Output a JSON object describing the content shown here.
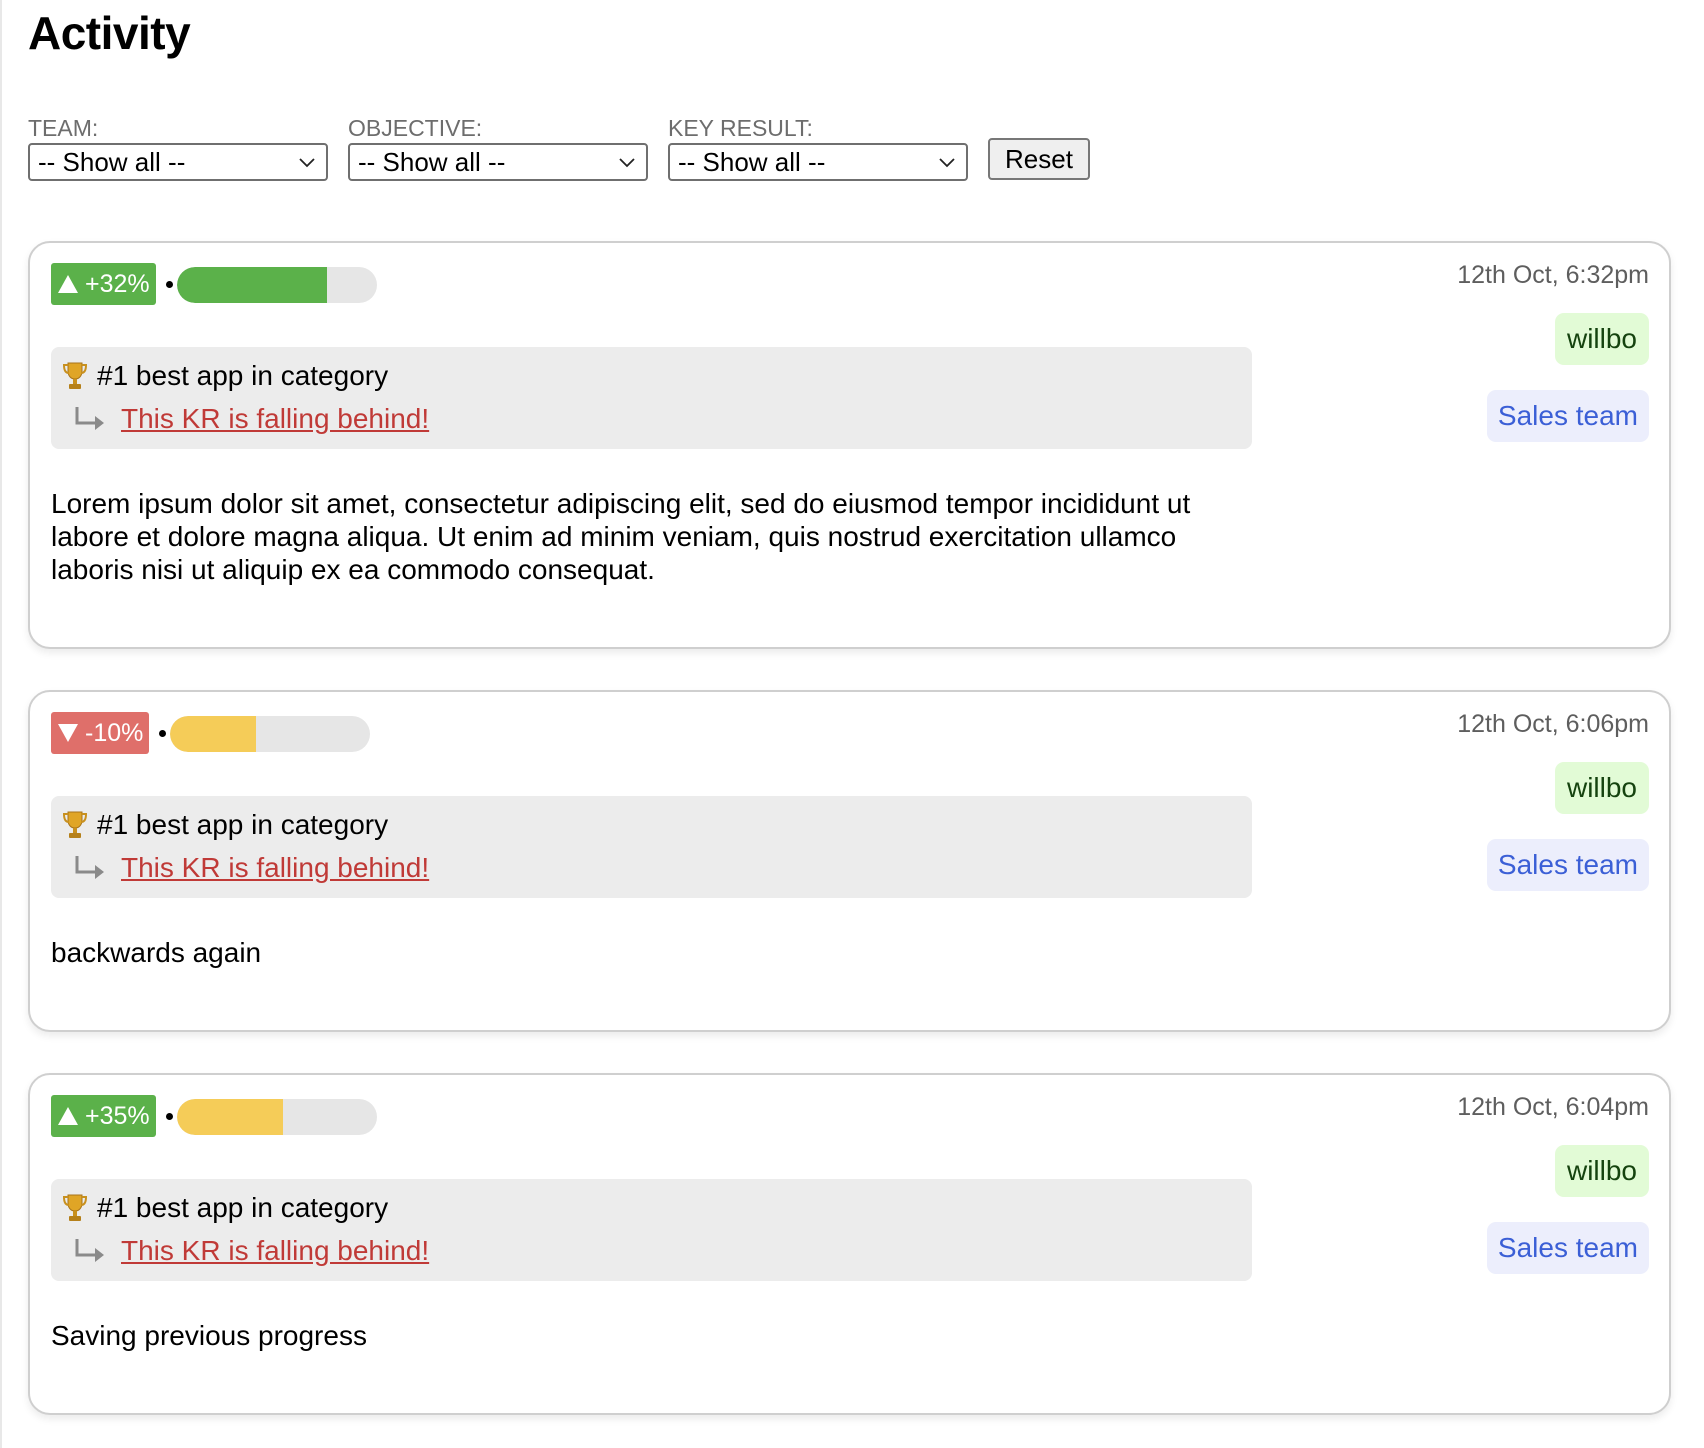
{
  "page": {
    "title": "Activity"
  },
  "filters": {
    "team": {
      "label": "TEAM:",
      "value": "-- Show all --"
    },
    "objective": {
      "label": "OBJECTIVE:",
      "value": "-- Show all --"
    },
    "key_result": {
      "label": "KEY RESULT:",
      "value": "-- Show all --"
    },
    "reset_label": "Reset"
  },
  "colors": {
    "up": "#5bb14a",
    "down": "#df6f6a",
    "progress_green": "#5bb14a",
    "progress_yellow": "#f5cc58",
    "progress_track": "#e6e6e6",
    "link_red": "#c03a37",
    "user_tag_bg": "#e2fbd6",
    "team_tag_bg": "#eceefc",
    "team_tag_text": "#3b5fd6"
  },
  "activities": [
    {
      "direction": "up",
      "change": "+32%",
      "progress": 0.75,
      "progress_color": "green",
      "timestamp": "12th Oct, 6:32pm",
      "user": "willbo",
      "team": "Sales team",
      "objective_icon": "trophy-icon",
      "objective": "#1 best app in category",
      "key_result": "This KR is falling behind!",
      "comment": "Lorem ipsum dolor sit amet, consectetur adipiscing elit, sed do eiusmod tempor incididunt ut labore et dolore magna aliqua. Ut enim ad minim veniam, quis nostrud exercitation ullamco laboris nisi ut aliquip ex ea commodo consequat."
    },
    {
      "direction": "down",
      "change": "-10%",
      "progress": 0.43,
      "progress_color": "yellow",
      "timestamp": "12th Oct, 6:06pm",
      "user": "willbo",
      "team": "Sales team",
      "objective_icon": "trophy-icon",
      "objective": "#1 best app in category",
      "key_result": "This KR is falling behind!",
      "comment": "backwards again"
    },
    {
      "direction": "up",
      "change": "+35%",
      "progress": 0.53,
      "progress_color": "yellow",
      "timestamp": "12th Oct, 6:04pm",
      "user": "willbo",
      "team": "Sales team",
      "objective_icon": "trophy-icon",
      "objective": "#1 best app in category",
      "key_result": "This KR is falling behind!",
      "comment": "Saving previous progress"
    }
  ]
}
